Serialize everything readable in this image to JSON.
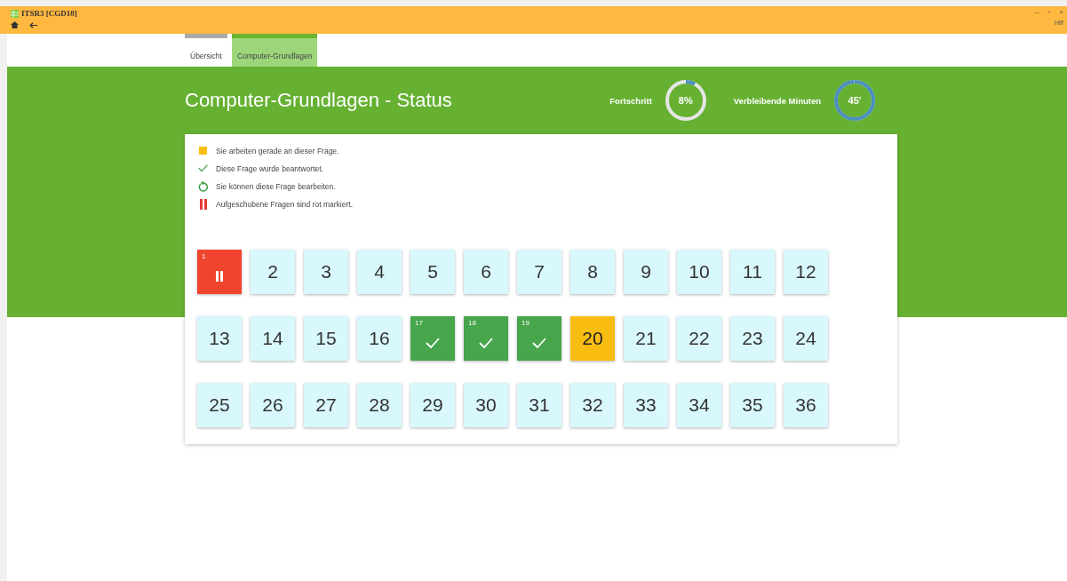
{
  "window": {
    "title": "ITSR3 [CGD18]",
    "controls": [
      "–",
      "▫",
      "×"
    ],
    "help": "Hilf"
  },
  "tabs": [
    {
      "label": "Übersicht",
      "selected": false
    },
    {
      "label": "Computer-Grundlagen",
      "selected": true
    }
  ],
  "header": {
    "title": "Computer-Grundlagen - Status",
    "progress": {
      "label": "Fortschritt",
      "reading": "8%",
      "level": 0.08
    },
    "minutes": {
      "label": "Verbleibende Minuten",
      "reading": "45'",
      "level": 0.99
    }
  },
  "legend": [
    {
      "kind": "current",
      "text": "Sie arbeiten gerade an dieser Frage."
    },
    {
      "kind": "answered",
      "text": "Diese Frage wurde beantwortet."
    },
    {
      "kind": "open",
      "text": "Sie können diese Frage bearbeiten."
    },
    {
      "kind": "postponed",
      "text": "Aufgeschobene Fragen sind rot markiert."
    }
  ],
  "questions": [
    {
      "number": "1",
      "kind": "postponed"
    },
    {
      "number": "2",
      "kind": "open"
    },
    {
      "number": "3",
      "kind": "open"
    },
    {
      "number": "4",
      "kind": "open"
    },
    {
      "number": "5",
      "kind": "open"
    },
    {
      "number": "6",
      "kind": "open"
    },
    {
      "number": "7",
      "kind": "open"
    },
    {
      "number": "8",
      "kind": "open"
    },
    {
      "number": "9",
      "kind": "open"
    },
    {
      "number": "10",
      "kind": "open"
    },
    {
      "number": "11",
      "kind": "open"
    },
    {
      "number": "12",
      "kind": "open"
    },
    {
      "number": "13",
      "kind": "open"
    },
    {
      "number": "14",
      "kind": "open"
    },
    {
      "number": "15",
      "kind": "open"
    },
    {
      "number": "16",
      "kind": "open"
    },
    {
      "number": "17",
      "kind": "answered"
    },
    {
      "number": "18",
      "kind": "answered"
    },
    {
      "number": "19",
      "kind": "answered"
    },
    {
      "number": "20",
      "kind": "current"
    },
    {
      "number": "21",
      "kind": "open"
    },
    {
      "number": "22",
      "kind": "open"
    },
    {
      "number": "23",
      "kind": "open"
    },
    {
      "number": "24",
      "kind": "open"
    },
    {
      "number": "25",
      "kind": "open"
    },
    {
      "number": "26",
      "kind": "open"
    },
    {
      "number": "27",
      "kind": "open"
    },
    {
      "number": "28",
      "kind": "open"
    },
    {
      "number": "29",
      "kind": "open"
    },
    {
      "number": "30",
      "kind": "open"
    },
    {
      "number": "31",
      "kind": "open"
    },
    {
      "number": "32",
      "kind": "open"
    },
    {
      "number": "33",
      "kind": "open"
    },
    {
      "number": "34",
      "kind": "open"
    },
    {
      "number": "35",
      "kind": "open"
    },
    {
      "number": "36",
      "kind": "open"
    }
  ]
}
